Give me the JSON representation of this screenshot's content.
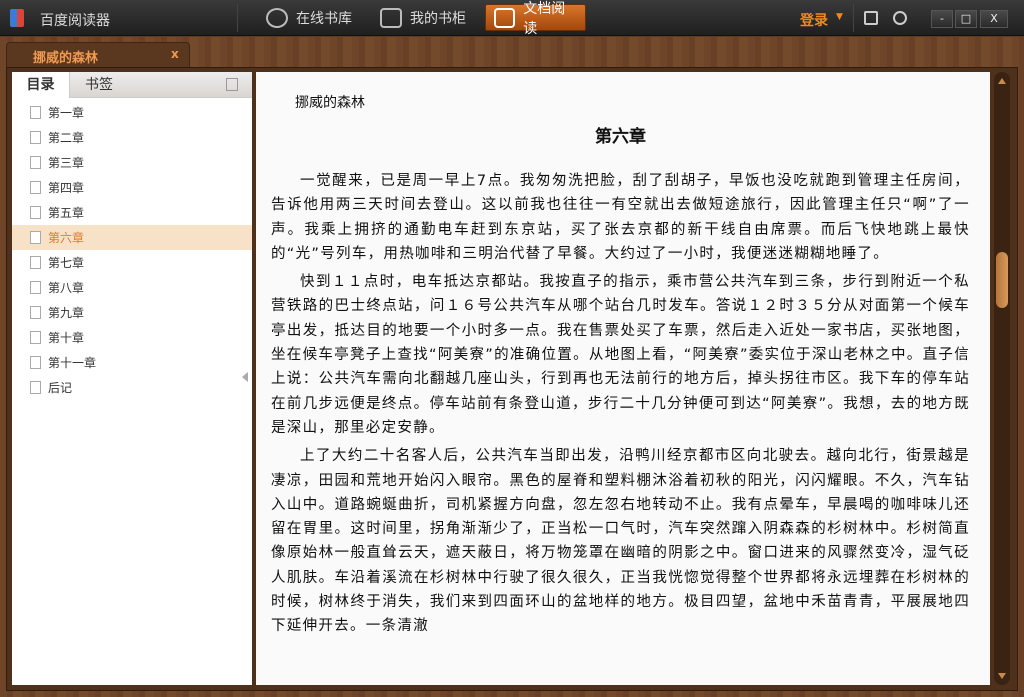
{
  "app": {
    "title": "百度阅读器"
  },
  "nav": [
    {
      "label": "在线书库",
      "icon": "globe-icon"
    },
    {
      "label": "我的书柜",
      "icon": "bookshelf-icon"
    },
    {
      "label": "文档阅读",
      "icon": "open-book-icon",
      "active": true
    }
  ],
  "header": {
    "login": "登录",
    "min": "-",
    "max": "□",
    "close": "X"
  },
  "doc_tab": {
    "title": "挪威的森林",
    "close": "x"
  },
  "sidebar": {
    "tabs": [
      "目录",
      "书签"
    ],
    "active_tab": 0,
    "items": [
      "第一章",
      "第二章",
      "第三章",
      "第四章",
      "第五章",
      "第六章",
      "第七章",
      "第八章",
      "第九章",
      "第十章",
      "第十一章",
      "后记"
    ],
    "active_item": 5
  },
  "reader": {
    "book_title": "挪威的森林",
    "chapter": "第六章",
    "paragraphs": [
      "一觉醒来，已是周一早上7点。我匆匆洗把脸，刮了刮胡子，早饭也没吃就跑到管理主任房间，告诉他用两三天时间去登山。这以前我也往往一有空就出去做短途旅行，因此管理主任只“啊”了一声。我乘上拥挤的通勤电车赶到东京站，买了张去京都的新干线自由席票。而后飞快地跳上最快的“光”号列车，用热咖啡和三明治代替了早餐。大约过了一小时，我便迷迷糊糊地睡了。",
      "快到１１点时，电车抵达京都站。我按直子的指示，乘市营公共汽车到三条，步行到附近一个私营铁路的巴士终点站，问１６号公共汽车从哪个站台几时发车。答说１２时３５分从对面第一个候车亭出发，抵达目的地要一个小时多一点。我在售票处买了车票，然后走入近处一家书店，买张地图，坐在候车亭凳子上查找“阿美寮”的准确位置。从地图上看，“阿美寮”委实位于深山老林之中。直子信上说：公共汽车需向北翻越几座山头，行到再也无法前行的地方后，掉头拐往市区。我下车的停车站在前几步远便是终点。停车站前有条登山道，步行二十几分钟便可到达“阿美寮”。我想，去的地方既是深山，那里必定安静。",
      "上了大约二十名客人后，公共汽车当即出发，沿鸭川经京都市区向北驶去。越向北行，街景越是凄凉，田园和荒地开始闪入眼帘。黑色的屋脊和塑料棚沐浴着初秋的阳光，闪闪耀眼。不久，汽车钻入山中。道路蜿蜒曲折，司机紧握方向盘，忽左忽右地转动不止。我有点晕车，早晨喝的咖啡味儿还留在胃里。这时间里，拐角渐渐少了，正当松一口气时，汽车突然蹿入阴森森的杉树林中。杉树简直像原始林一般直耸云天，遮天蔽日，将万物笼罩在幽暗的阴影之中。窗口进来的风骤然变冷，湿气砭人肌肤。车沿着溪流在杉树林中行驶了很久很久，正当我恍惚觉得整个世界都将永远埋葬在杉树林的时候，树林终于消失，我们来到四面环山的盆地样的地方。极目四望，盆地中禾苗青青，平展展地四下延伸开去。一条清澈"
    ]
  }
}
